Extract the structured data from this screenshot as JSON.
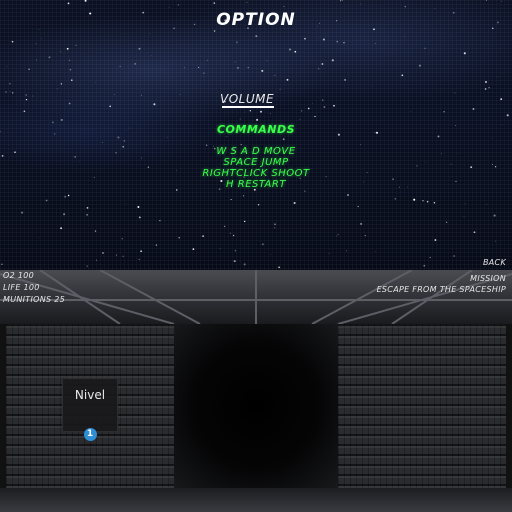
{
  "menu": {
    "title": "OPTION",
    "volume_label": "VOLUME",
    "commands_label": "COMMANDS",
    "commands": [
      "W S A D MOVE",
      "SPACE JUMP",
      "RIGHTCLICK SHOOT",
      "H RESTART"
    ]
  },
  "hud": {
    "o2": "O2 100",
    "life": "LIFE 100",
    "munitions": "MUNITIONS 25",
    "back": "BACK",
    "mission_label": "MISSION",
    "mission_text": "ESCAPE FROM THE SPACESHIP"
  },
  "level": {
    "label": "Nivel",
    "number": "1"
  },
  "colors": {
    "accent_green": "#39ff4a",
    "level_badge": "#2f8fd6"
  }
}
